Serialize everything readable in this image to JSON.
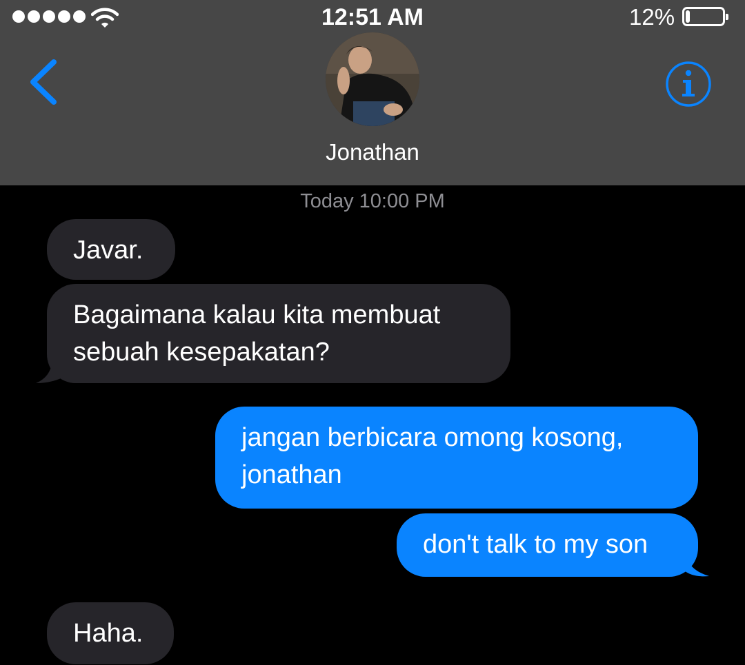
{
  "status_bar": {
    "time": "12:51 AM",
    "battery_percent": "12%",
    "battery_level": 0.12,
    "signal_dots": 5
  },
  "header": {
    "contact_name": "Jonathan",
    "back_icon": "chevron-left-icon",
    "info_icon": "info-icon",
    "accent_color": "#0a84ff"
  },
  "conversation": {
    "timestamp": "Today 10:00 PM",
    "messages": [
      {
        "direction": "incoming",
        "text": "Javar."
      },
      {
        "direction": "incoming",
        "text": "Bagaimana kalau kita membuat\nsebuah kesepakatan?"
      },
      {
        "direction": "outgoing",
        "text": "jangan berbicara omong kosong,\njonathan"
      },
      {
        "direction": "outgoing",
        "text": "don't talk to my son"
      },
      {
        "direction": "incoming",
        "text": "Haha."
      }
    ]
  }
}
